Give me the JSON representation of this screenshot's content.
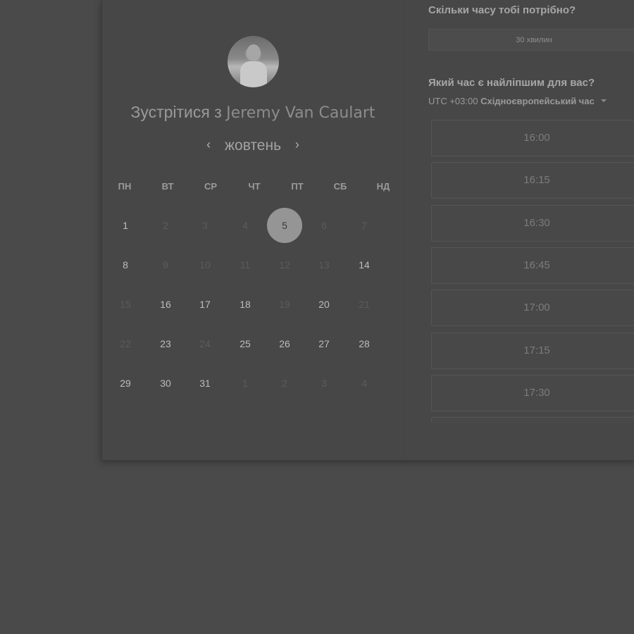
{
  "calendar": {
    "title_prefix": "Зустрітися з",
    "host_name": "Jeremy Van Caulart",
    "month": "жовтень",
    "prev_arrow": "‹",
    "next_arrow": "›",
    "weekdays": [
      "ПН",
      "ВТ",
      "СР",
      "ЧТ",
      "ПТ",
      "СБ",
      "НД"
    ],
    "weeks": [
      [
        {
          "d": "1",
          "s": "available"
        },
        {
          "d": "2",
          "s": "muted"
        },
        {
          "d": "3",
          "s": "muted"
        },
        {
          "d": "4",
          "s": "muted"
        },
        {
          "d": "5",
          "s": "selected"
        },
        {
          "d": "6",
          "s": "muted"
        },
        {
          "d": "7",
          "s": "muted"
        }
      ],
      [
        {
          "d": "8",
          "s": "available"
        },
        {
          "d": "9",
          "s": "muted"
        },
        {
          "d": "10",
          "s": "muted"
        },
        {
          "d": "11",
          "s": "muted"
        },
        {
          "d": "12",
          "s": "muted"
        },
        {
          "d": "13",
          "s": "muted"
        },
        {
          "d": "14",
          "s": "available"
        }
      ],
      [
        {
          "d": "15",
          "s": "muted"
        },
        {
          "d": "16",
          "s": "available"
        },
        {
          "d": "17",
          "s": "available"
        },
        {
          "d": "18",
          "s": "available"
        },
        {
          "d": "19",
          "s": "muted"
        },
        {
          "d": "20",
          "s": "available"
        },
        {
          "d": "21",
          "s": "muted"
        }
      ],
      [
        {
          "d": "22",
          "s": "muted"
        },
        {
          "d": "23",
          "s": "available"
        },
        {
          "d": "24",
          "s": "muted"
        },
        {
          "d": "25",
          "s": "available"
        },
        {
          "d": "26",
          "s": "available"
        },
        {
          "d": "27",
          "s": "available"
        },
        {
          "d": "28",
          "s": "available"
        }
      ],
      [
        {
          "d": "29",
          "s": "available"
        },
        {
          "d": "30",
          "s": "available"
        },
        {
          "d": "31",
          "s": "available"
        },
        {
          "d": "1",
          "s": "muted"
        },
        {
          "d": "2",
          "s": "muted"
        },
        {
          "d": "3",
          "s": "muted"
        },
        {
          "d": "4",
          "s": "muted"
        }
      ]
    ]
  },
  "booking": {
    "duration_question": "Скільки часу тобі потрібно?",
    "duration_value": "30 хвилин",
    "time_question": "Який час є найліпшим для вас?",
    "timezone_offset": "UTC +03:00",
    "timezone_name": "Східноєвропейський час",
    "slots": [
      "16:00",
      "16:15",
      "16:30",
      "16:45",
      "17:00",
      "17:15",
      "17:30"
    ]
  },
  "colors": {
    "backdrop": "#4a4a4a",
    "selected_day": "#959595"
  }
}
